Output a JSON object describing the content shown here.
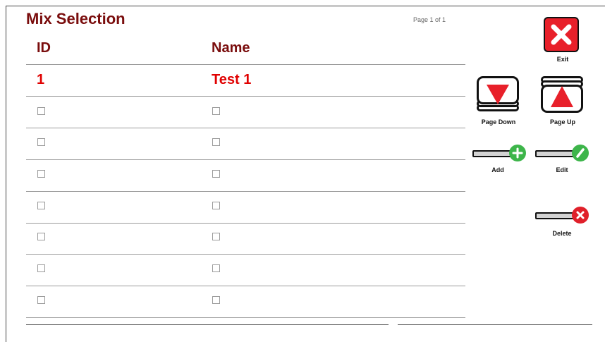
{
  "title": "Mix Selection",
  "page_indicator": "Page 1 of 1",
  "table": {
    "headers": {
      "id": "ID",
      "name": "Name"
    },
    "rows": [
      {
        "id": "1",
        "name": "Test 1"
      }
    ],
    "empty_rows": 7
  },
  "buttons": {
    "exit": {
      "label": "Exit",
      "icon": "close-icon"
    },
    "page_down": {
      "label": "Page Down",
      "icon": "page-down-icon"
    },
    "page_up": {
      "label": "Page Up",
      "icon": "page-up-icon"
    },
    "add": {
      "label": "Add",
      "icon": "plus-icon"
    },
    "edit": {
      "label": "Edit",
      "icon": "pencil-icon"
    },
    "delete": {
      "label": "Delete",
      "icon": "delete-x-icon"
    }
  },
  "colors": {
    "title": "#7a0d0d",
    "row_text": "#e00000",
    "exit_bg": "#e8202a",
    "add_badge": "#3db54a",
    "edit_badge": "#3db54a",
    "delete_badge": "#e0202a"
  }
}
